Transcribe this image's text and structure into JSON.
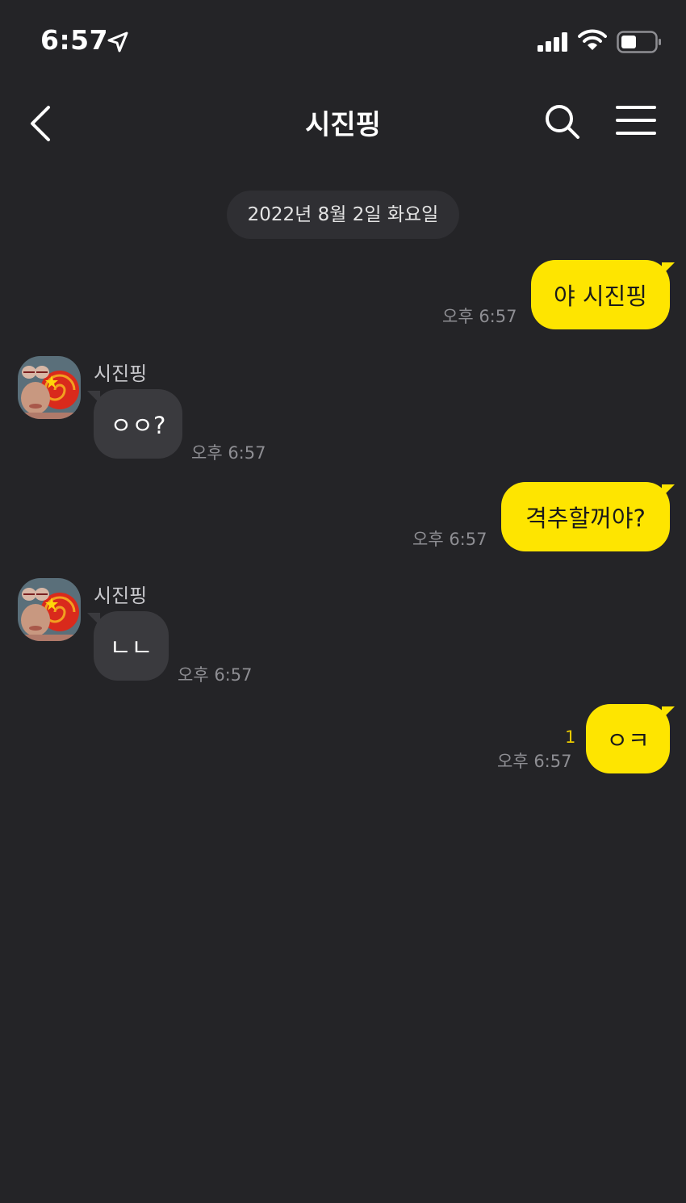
{
  "status_bar": {
    "time": "6:57",
    "icons": [
      "location-arrow-icon",
      "signal-icon",
      "wifi-icon",
      "battery-icon"
    ]
  },
  "header": {
    "title": "시진핑",
    "icons": [
      "back-chevron-icon",
      "search-icon",
      "menu-icon"
    ]
  },
  "date_divider": "2022년 8월 2일 화요일",
  "messages": [
    {
      "side": "mine",
      "text": "야 시진핑",
      "time": "오후 6:57"
    },
    {
      "side": "theirs",
      "sender": "시진핑",
      "text": "ㅇㅇ?",
      "time": "오후 6:57"
    },
    {
      "side": "mine",
      "text": "격추할꺼야?",
      "time": "오후 6:57"
    },
    {
      "side": "theirs",
      "sender": "시진핑",
      "text": "ㄴㄴ",
      "time": "오후 6:57"
    },
    {
      "side": "mine",
      "text": "ㅇㅋ",
      "time": "오후 6:57",
      "unread": "1"
    }
  ],
  "colors": {
    "background": "#242427",
    "my_bubble": "#fee500",
    "their_bubble": "#3a3a3e",
    "unread": "#e8c900"
  }
}
